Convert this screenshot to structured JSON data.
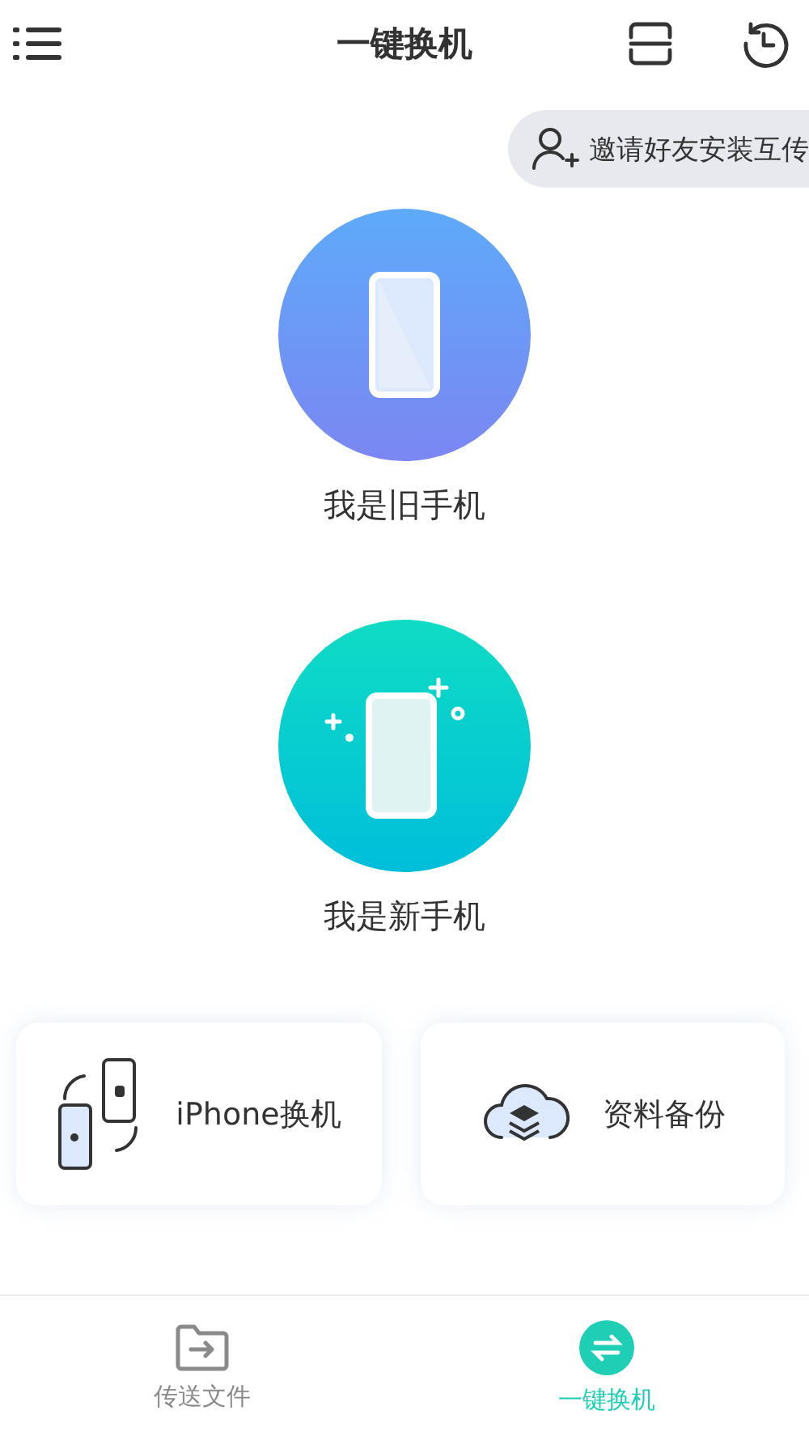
{
  "header": {
    "title": "一键换机"
  },
  "invite": {
    "label": "邀请好友安装互传"
  },
  "roles": [
    {
      "kind": "old",
      "label": "我是旧手机"
    },
    {
      "kind": "new",
      "label": "我是新手机"
    }
  ],
  "cards": [
    {
      "kind": "iphone",
      "label": "iPhone换机"
    },
    {
      "kind": "backup",
      "label": "资料备份"
    }
  ],
  "tabs": [
    {
      "kind": "files",
      "label": "传送文件",
      "selected": false
    },
    {
      "kind": "switch",
      "label": "一键换机",
      "selected": true
    }
  ]
}
